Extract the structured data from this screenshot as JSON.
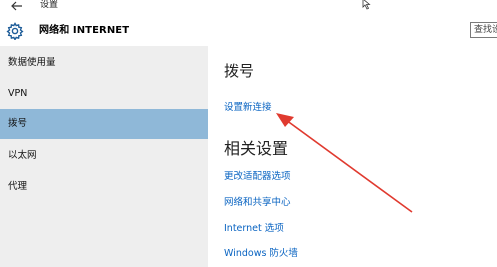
{
  "window": {
    "title": "设置"
  },
  "header": {
    "title": "网络和 INTERNET",
    "search_placeholder": "查找设置"
  },
  "sidebar": {
    "items": [
      {
        "label": "数据使用量",
        "selected": false
      },
      {
        "label": "VPN",
        "selected": false
      },
      {
        "label": "拨号",
        "selected": true
      },
      {
        "label": "以太网",
        "selected": false
      },
      {
        "label": "代理",
        "selected": false
      }
    ]
  },
  "main": {
    "heading": "拨号",
    "setup_link": "设置新连接",
    "related_heading": "相关设置",
    "related_links": [
      "更改适配器选项",
      "网络和共享中心",
      "Internet 选项",
      "Windows 防火墙"
    ]
  },
  "colors": {
    "accent_link": "#0a64c2",
    "sidebar_bg": "#eeeeee",
    "selected_bg": "#8fb8d8",
    "annotation_arrow": "#e03a2f"
  },
  "icons": [
    "back-arrow-icon",
    "gear-icon",
    "mouse-cursor-icon"
  ]
}
